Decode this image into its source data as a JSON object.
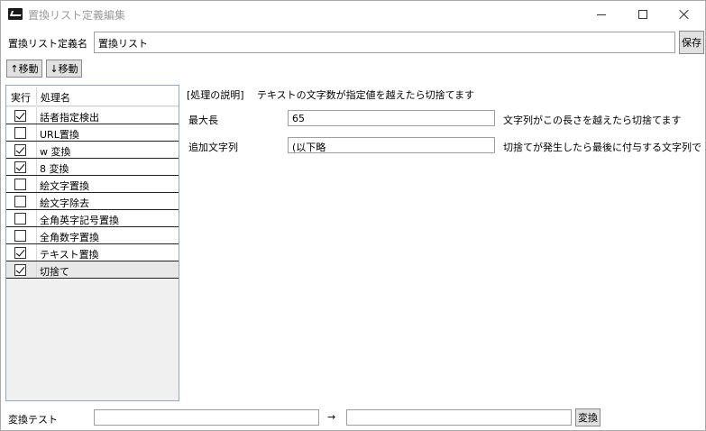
{
  "window": {
    "title": "置換リスト定義編集"
  },
  "header": {
    "name_label": "置換リスト定義名",
    "name_value": "置換リスト",
    "save_label": "保存"
  },
  "toolbar": {
    "move_up": "↑移動",
    "move_down": "↓移動"
  },
  "list": {
    "col_exec": "実行",
    "col_name": "処理名",
    "items": [
      {
        "label": "話者指定検出",
        "checked": true
      },
      {
        "label": "URL置換",
        "checked": false
      },
      {
        "label": "w 変換",
        "checked": true
      },
      {
        "label": "8 変換",
        "checked": true
      },
      {
        "label": "絵文字置換",
        "checked": false
      },
      {
        "label": "絵文字除去",
        "checked": false
      },
      {
        "label": "全角英字記号置換",
        "checked": false
      },
      {
        "label": "全角数字置換",
        "checked": false
      },
      {
        "label": "テキスト置換",
        "checked": true
      },
      {
        "label": "切捨て",
        "checked": true
      }
    ]
  },
  "detail": {
    "desc_tag": "[処理の説明]",
    "desc_text": "テキストの文字数が指定値を越えたら切捨てます",
    "max_len_label": "最大長",
    "max_len_value": "65",
    "max_len_hint": "文字列がこの長さを越えたら切捨てます",
    "append_label": "追加文字列",
    "append_value": "(以下略",
    "append_hint": "切捨てが発生したら最後に付与する文字列で"
  },
  "test": {
    "label": "変換テスト",
    "input_value": "",
    "arrow": "→",
    "output_value": "",
    "convert_label": "変換"
  }
}
